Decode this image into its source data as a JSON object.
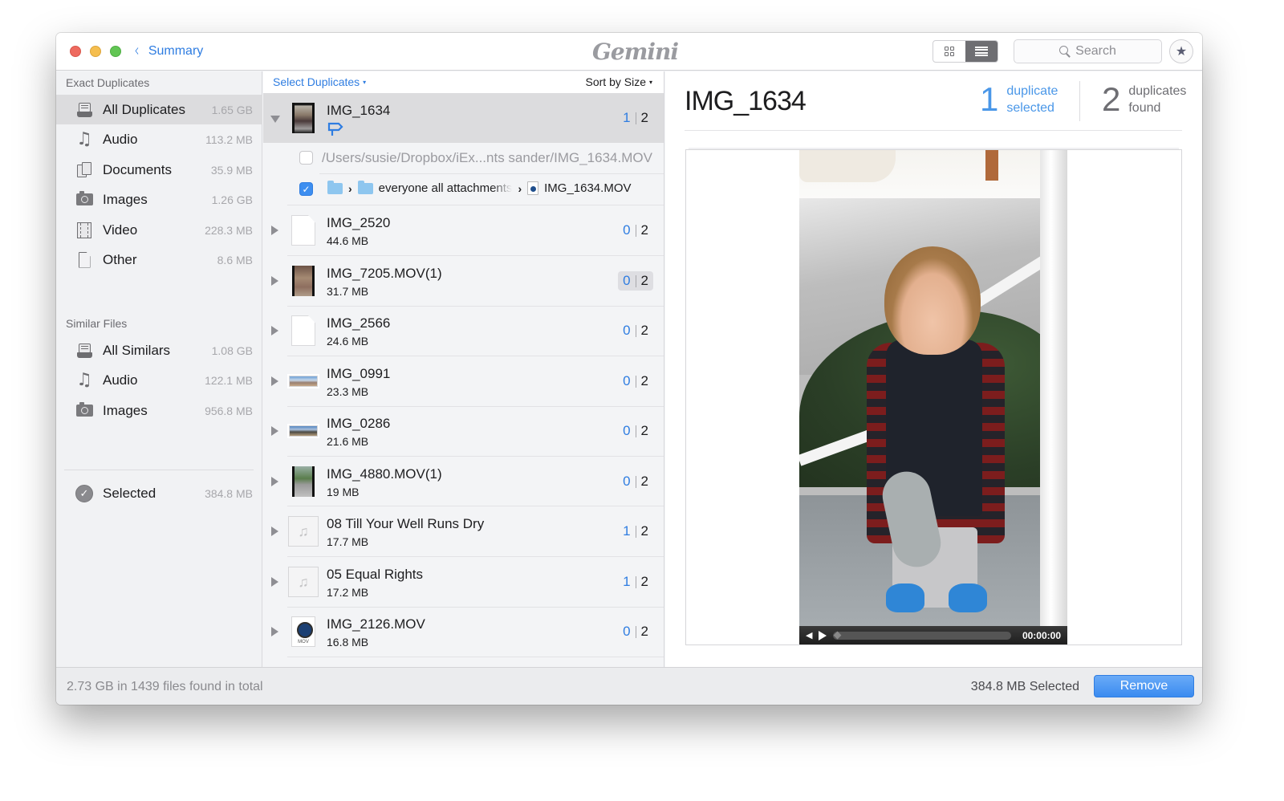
{
  "window": {
    "title_logo": "Gemini",
    "back_button": {
      "label": "Summary",
      "icon": "chevron-left-icon"
    },
    "view_modes": [
      {
        "name": "grid-view",
        "icon": "grid-icon",
        "active": false
      },
      {
        "name": "list-view",
        "icon": "list-icon",
        "active": true
      }
    ],
    "search": {
      "placeholder": "Search",
      "value": ""
    },
    "favorite_icon": "star-icon",
    "accent_color": "#2f7de1"
  },
  "sidebar": {
    "exact_label": "Exact Duplicates",
    "exact_items": [
      {
        "icon": "tray-icon",
        "label": "All Duplicates",
        "size": "1.65 GB",
        "active": true
      },
      {
        "icon": "music-note-icon",
        "label": "Audio",
        "size": "113.2 MB"
      },
      {
        "icon": "documents-icon",
        "label": "Documents",
        "size": "35.9 MB"
      },
      {
        "icon": "camera-icon",
        "label": "Images",
        "size": "1.26 GB"
      },
      {
        "icon": "film-icon",
        "label": "Video",
        "size": "228.3 MB"
      },
      {
        "icon": "file-icon",
        "label": "Other",
        "size": "8.6 MB"
      }
    ],
    "similar_label": "Similar Files",
    "similar_items": [
      {
        "icon": "tray-icon",
        "label": "All Similars",
        "size": "1.08 GB"
      },
      {
        "icon": "music-note-icon",
        "label": "Audio",
        "size": "122.1 MB"
      },
      {
        "icon": "camera-icon",
        "label": "Images",
        "size": "956.8 MB"
      }
    ],
    "selected": {
      "icon": "checkmark-circle-icon",
      "label": "Selected",
      "size": "384.8 MB"
    }
  },
  "list": {
    "select_duplicates": "Select Duplicates",
    "sort_by": "Sort by Size",
    "caret": "▾",
    "expanded": {
      "name": "IMG_1634",
      "selected": "1",
      "total": "2",
      "paths": [
        {
          "checked": false,
          "text": "/Users/susie/Dropbox/iEx...nts sander/IMG_1634.MOV"
        },
        {
          "checked": true,
          "crumbs": [
            "everyone all attachments",
            "IMG_1634.MOV"
          ]
        }
      ]
    },
    "items": [
      {
        "name": "IMG_2520",
        "size": "44.6 MB",
        "selected": "0",
        "total": "2",
        "thumb": "document"
      },
      {
        "name": "IMG_7205.MOV(1)",
        "size": "31.7 MB",
        "selected": "0",
        "total": "2",
        "thumb": "photo-brown",
        "hover": true
      },
      {
        "name": "IMG_2566",
        "size": "24.6 MB",
        "selected": "0",
        "total": "2",
        "thumb": "document"
      },
      {
        "name": "IMG_0991",
        "size": "23.3 MB",
        "selected": "0",
        "total": "2",
        "thumb": "panorama"
      },
      {
        "name": "IMG_0286",
        "size": "21.6 MB",
        "selected": "0",
        "total": "2",
        "thumb": "panorama-dark"
      },
      {
        "name": "IMG_4880.MOV(1)",
        "size": "19 MB",
        "selected": "0",
        "total": "2",
        "thumb": "photo-path"
      },
      {
        "name": "08 Till Your Well Runs Dry",
        "size": "17.7 MB",
        "selected": "1",
        "total": "2",
        "thumb": "audio"
      },
      {
        "name": "05 Equal Rights",
        "size": "17.2 MB",
        "selected": "1",
        "total": "2",
        "thumb": "audio"
      },
      {
        "name": "IMG_2126.MOV",
        "size": "16.8 MB",
        "selected": "0",
        "total": "2",
        "thumb": "quicktime"
      }
    ]
  },
  "detail": {
    "title": "IMG_1634",
    "selected_count": "1",
    "selected_label_1": "duplicate",
    "selected_label_2": "selected",
    "found_count": "2",
    "found_label_1": "duplicates",
    "found_label_2": "found",
    "player": {
      "time": "00:00:00",
      "progress": 0
    }
  },
  "footer": {
    "summary": "2.73 GB in 1439 files found in total",
    "selected_total": "384.8 MB Selected",
    "remove_label": "Remove"
  }
}
